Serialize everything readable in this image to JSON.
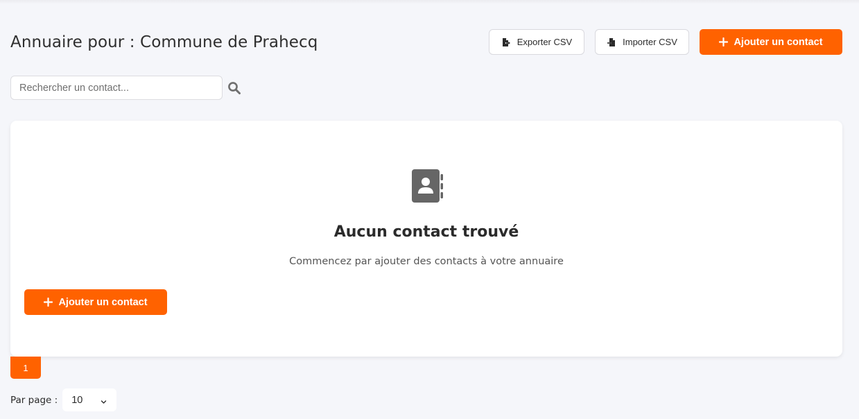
{
  "header": {
    "title": "Annuaire pour : Commune de Prahecq",
    "export_label": "Exporter CSV",
    "import_label": "Importer CSV",
    "add_label": "Ajouter un contact"
  },
  "search": {
    "placeholder": "Rechercher un contact...",
    "value": ""
  },
  "empty_state": {
    "icon": "address-book-icon",
    "title": "Aucun contact trouvé",
    "subtitle": "Commencez par ajouter des contacts à votre annuaire",
    "add_label": "Ajouter un contact"
  },
  "pagination": {
    "current_page": "1"
  },
  "per_page": {
    "label": "Par page :",
    "selected": "10"
  },
  "colors": {
    "accent": "#ff6200",
    "background": "#f5f6fa",
    "card": "#ffffff",
    "icon": "#666666"
  }
}
